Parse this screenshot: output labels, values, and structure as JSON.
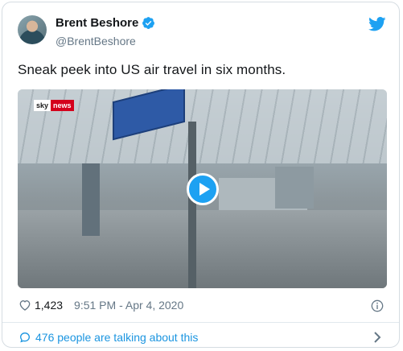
{
  "user": {
    "display_name": "Brent Beshore",
    "handle": "@BrentBeshore",
    "verified": true
  },
  "tweet": {
    "text": "Sneak peek into US air travel in six months."
  },
  "media": {
    "type": "video",
    "watermark": {
      "sky": "sky",
      "news": "news"
    }
  },
  "meta": {
    "likes": "1,423",
    "timestamp": "9:51 PM - Apr 4, 2020"
  },
  "footer": {
    "talk_label": "476 people are talking about this"
  },
  "colors": {
    "accent": "#1da1f2",
    "link": "#1b95e0",
    "muted": "#657786"
  },
  "icons": [
    "verified-badge-icon",
    "twitter-bird-icon",
    "play-icon",
    "heart-icon",
    "info-icon",
    "speech-bubble-icon",
    "chevron-right-icon"
  ]
}
